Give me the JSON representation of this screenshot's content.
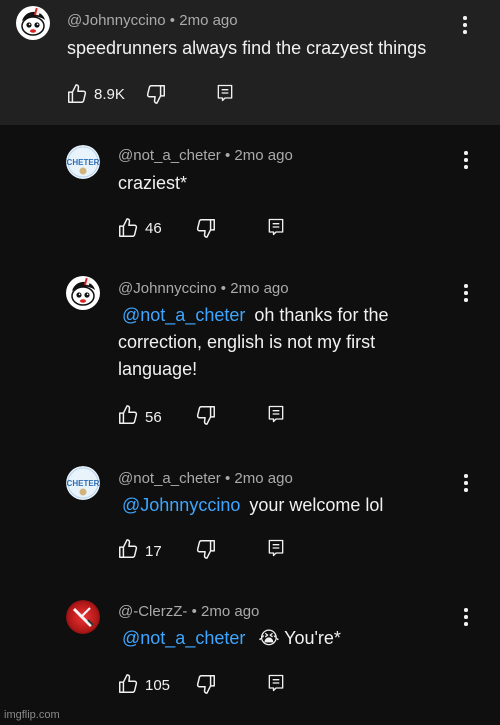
{
  "colors": {
    "background": "#0f0f0f",
    "top_comment_bg": "#212121",
    "mention": "#3ea6ff",
    "meta": "#aaaaaa"
  },
  "comments": [
    {
      "author": "@Johnnyccino",
      "time": "2mo ago",
      "text": "speedrunners always find the crazyest things",
      "likes": "8.9K",
      "avatar_icon": "cuphead-avatar-icon"
    },
    {
      "author": "@not_a_cheter",
      "time": "2mo ago",
      "text": "craziest*",
      "likes": "46",
      "avatar_icon": "cheter-avatar-icon"
    },
    {
      "author": "@Johnnyccino",
      "time": "2mo ago",
      "mention": "@not_a_cheter",
      "text_line1": "oh thanks for the",
      "text_line2": "correction, english is not my first",
      "text_line3": "language!",
      "likes": "56",
      "avatar_icon": "cuphead-avatar-icon"
    },
    {
      "author": "@not_a_cheter",
      "time": "2mo ago",
      "mention": "@Johnnyccino",
      "text": "your welcome lol",
      "likes": "17",
      "avatar_icon": "cheter-avatar-icon"
    },
    {
      "author": "@-ClerzZ-",
      "time": "2mo ago",
      "mention": "@not_a_cheter",
      "emoji": "😭",
      "text": "You're*",
      "likes": "105",
      "avatar_icon": "red-sword-avatar-icon"
    }
  ],
  "separator": "•",
  "cheter_logo_text": "CHETER",
  "watermark": "imgflip.com"
}
